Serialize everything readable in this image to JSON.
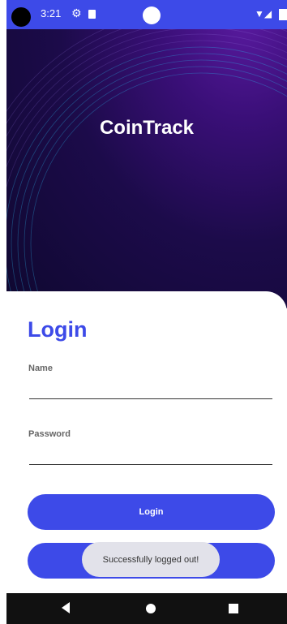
{
  "status_bar": {
    "time": "3:21",
    "icons": [
      "camera-cutout-icon",
      "gear-icon",
      "sim-card-icon",
      "wifi-icon",
      "signal-icon",
      "battery-icon"
    ]
  },
  "app": {
    "title": "CoinTrack"
  },
  "login": {
    "heading": "Login",
    "name_label": "Name",
    "name_value": "",
    "password_label": "Password",
    "password_value": "",
    "login_button": "Login",
    "second_button": ""
  },
  "toast": {
    "message": "Successfully logged out!"
  },
  "nav_bar": {
    "icons": [
      "back-icon",
      "home-icon",
      "recents-icon"
    ]
  },
  "colors": {
    "accent": "#3d4ae8",
    "hero_dark": "#0f0830",
    "hero_purple": "#5a1aa0",
    "toast_bg": "#e2e2ea"
  }
}
